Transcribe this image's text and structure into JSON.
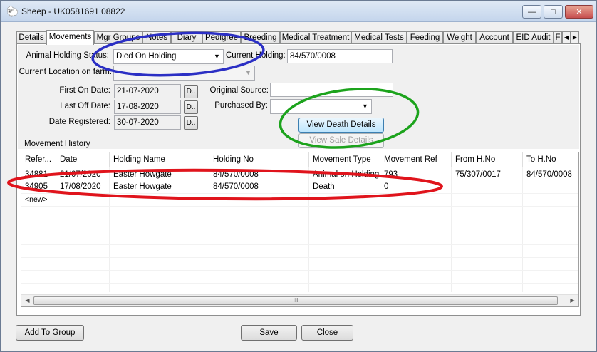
{
  "window": {
    "title": "Sheep - UK0581691 08822",
    "icon": "sheep-icon",
    "minimize": "—",
    "maximize": "□",
    "close": "✕"
  },
  "tabs": [
    "Details",
    "Movements",
    "Mgr Groups",
    "Notes",
    "Diary",
    "Pedigree",
    "Breeding",
    "Medical Treatment",
    "Medical Tests",
    "Feeding",
    "Weight",
    "Account",
    "EID Audit",
    "F"
  ],
  "active_tab": "Movements",
  "tab_scroll": {
    "left": "◀",
    "right": "▶"
  },
  "form": {
    "holding_status_label": "Animal Holding Status:",
    "holding_status_value": "Died On Holding",
    "current_holding_label": "Current Holding:",
    "current_holding_value": "84/570/0008",
    "current_location_label": "Current Location on farm:",
    "current_location_value": "",
    "first_on_label": "First On Date:",
    "first_on_value": "21-07-2020",
    "last_off_label": "Last Off Date:",
    "last_off_value": "17-08-2020",
    "date_registered_label": "Date Registered:",
    "date_registered_value": "30-07-2020",
    "date_button": "D..",
    "original_source_label": "Original Source:",
    "original_source_value": "",
    "purchased_by_label": "Purchased By:",
    "purchased_by_value": "",
    "view_death_button": "View Death Details",
    "view_sale_button": "View Sale Details",
    "dropdown_arrow": "▼"
  },
  "movement_history": {
    "title": "Movement History",
    "columns": [
      "Refer...",
      "Date",
      "Holding Name",
      "Holding No",
      "Movement Type",
      "Movement Ref",
      "From H.No",
      "To H.No"
    ],
    "rows": [
      [
        "34881",
        "21/07/2020",
        "Easter Howgate",
        "84/570/0008",
        "Animal on Holding",
        "793",
        "75/307/0017",
        "84/570/0008"
      ],
      [
        "34905",
        "17/08/2020",
        "Easter Howgate",
        "84/570/0008",
        "Death",
        "0",
        "",
        ""
      ]
    ],
    "new_row": "<new>",
    "scroll_left": "◀",
    "scroll_right": "▶",
    "scroll_grip": "III"
  },
  "footer": {
    "add_to_group": "Add To Group",
    "save": "Save",
    "close": "Close"
  },
  "annotation_colors": {
    "blue": "#2b2fc4",
    "green": "#1ca31c",
    "red": "#e0141c"
  }
}
